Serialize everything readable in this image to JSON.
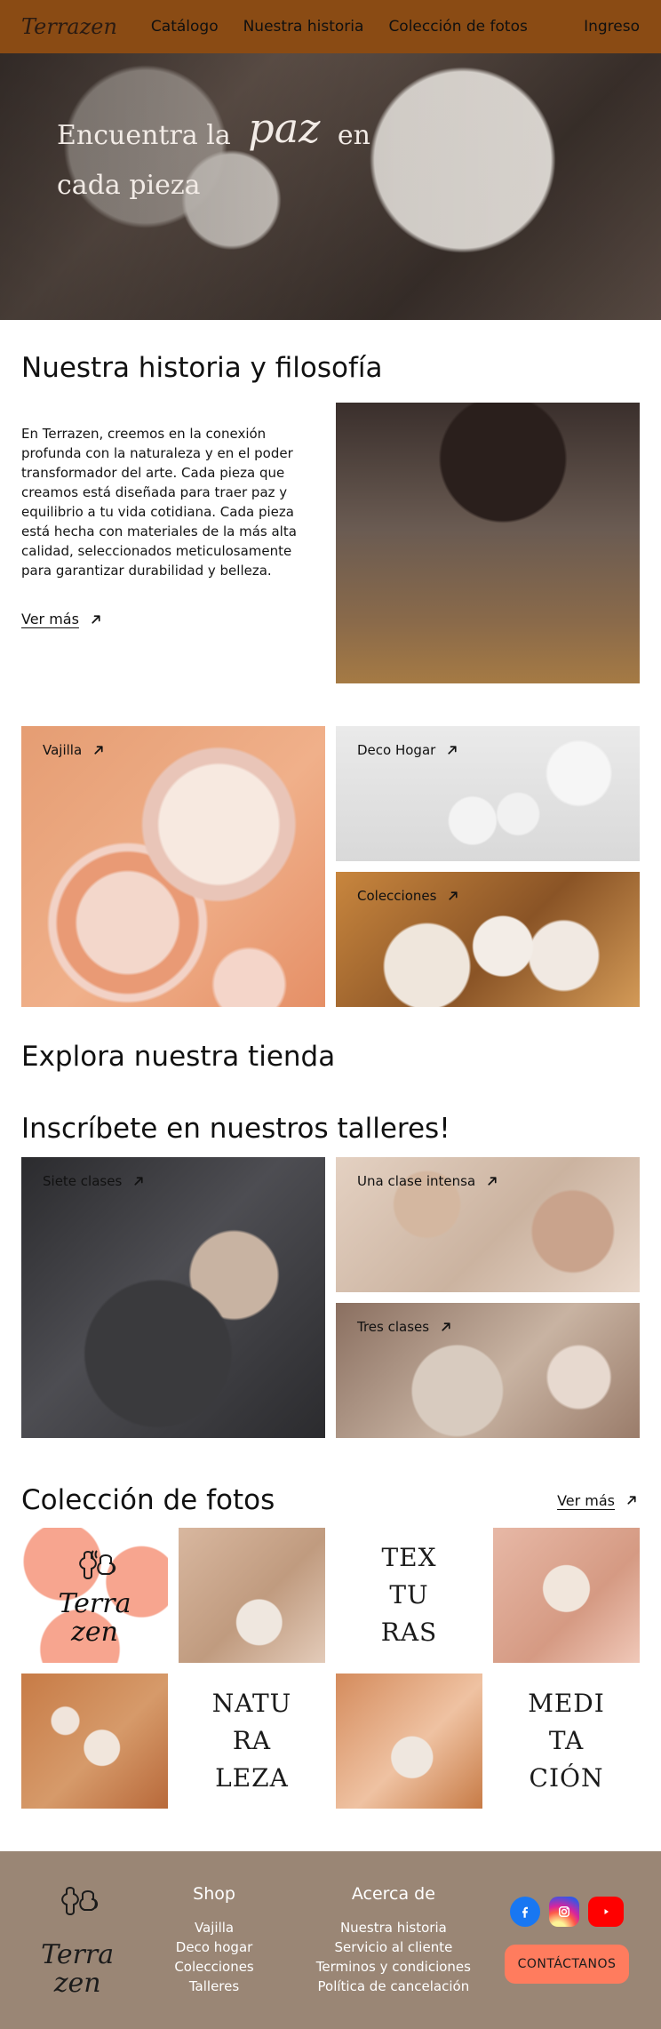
{
  "nav": {
    "brand": "Terrazen",
    "items": [
      "Catálogo",
      "Nuestra historia",
      "Colección de fotos",
      "Ingreso"
    ]
  },
  "hero": {
    "line_1_part_a": "Encuentra la",
    "line_1_emphasis": "paz",
    "line_1_part_b": "en",
    "line_2": "cada pieza"
  },
  "historia": {
    "title": "Nuestra historia y filosofía",
    "text": "En Terrazen, creemos en la conexión profunda con la naturaleza y en el poder transformador del arte. Cada pieza que creamos está diseñada para traer paz y equilibrio a tu vida cotidiana. Cada pieza está hecha con materiales de la más alta calidad, seleccionados meticulosamente para garantizar durabilidad y belleza.",
    "link": "Ver más"
  },
  "cards": {
    "vajilla": "Vajilla",
    "deco_hogar": "Deco Hogar",
    "colecciones": "Colecciones"
  },
  "explora": {
    "title": "Explora nuestra tienda"
  },
  "talleres": {
    "title": "Inscríbete en nuestros talleres!",
    "siete": "Siete clases",
    "intensa": "Una clase intensa",
    "tres": "Tres clases"
  },
  "fotos": {
    "title": "Colección de fotos",
    "link": "Ver más",
    "logo_text_1": "Terra",
    "logo_text_2": "zen",
    "word_texturas": [
      "TEX",
      "TU",
      "RAS"
    ],
    "word_naturaleza": [
      "NATU",
      "RA",
      "LEZA"
    ],
    "word_meditacion": [
      "MEDI",
      "TA",
      "CIÓN"
    ]
  },
  "footer": {
    "brand_1": "Terra",
    "brand_2": "zen",
    "shop_title": "Shop",
    "shop_links": [
      "Vajilla",
      "Deco hogar",
      "Colecciones",
      "Talleres"
    ],
    "about_title": "Acerca de",
    "about_links": [
      "Nuestra historia",
      "Servicio al cliente",
      "Terminos y condiciones",
      "Política de cancelación"
    ],
    "contact_button": "CONTÁCTANOS",
    "social_icons": [
      "facebook-icon",
      "instagram-icon",
      "youtube-icon"
    ]
  },
  "colors": {
    "nav_bg": "#8a4b14",
    "footer_bg": "#9a8675",
    "accent_salmon": "#ff7c5e"
  }
}
